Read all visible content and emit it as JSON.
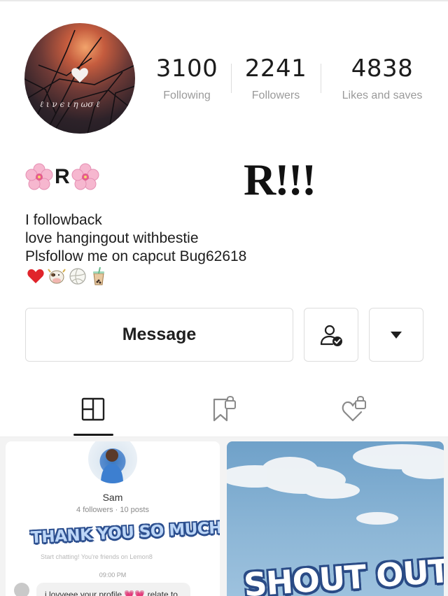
{
  "profile": {
    "name": "R",
    "big_name": "R!!!",
    "stats": {
      "following": {
        "value": "3100",
        "label": "Following"
      },
      "followers": {
        "value": "2241",
        "label": "Followers"
      },
      "likes": {
        "value": "4838",
        "label": "Likes and saves"
      }
    },
    "bio_lines": [
      "I followback",
      "love hangingout withbestie",
      "Plsfollow me on capcut Bug62618"
    ],
    "bio_emojis": [
      "heart-icon",
      "cow-icon",
      "volleyball-icon",
      "bubble-tea-icon"
    ]
  },
  "actions": {
    "message_label": "Message",
    "friend_icon": "user-check-icon",
    "more_icon": "caret-down-icon"
  },
  "tabs": [
    {
      "name": "posts",
      "icon": "grid-icon",
      "active": true
    },
    {
      "name": "saved",
      "icon": "bookmark-lock-icon",
      "active": false
    },
    {
      "name": "liked",
      "icon": "heart-lock-icon",
      "active": false
    }
  ],
  "posts": [
    {
      "mini_name": "Sam",
      "mini_meta": "4 followers · 10 posts",
      "overlay": "THANK YOU SO MUCH",
      "faint": "Start chatting! You're friends on Lemon8",
      "time": "09:00 PM",
      "chat": "i lovveee your profile 💗💗 relate to"
    },
    {
      "overlay": "SHOUT OUT"
    }
  ],
  "colors": {
    "stat_label": "#9a9a9a",
    "border": "#dddddd",
    "accent_dark": "#1a1a1a"
  }
}
